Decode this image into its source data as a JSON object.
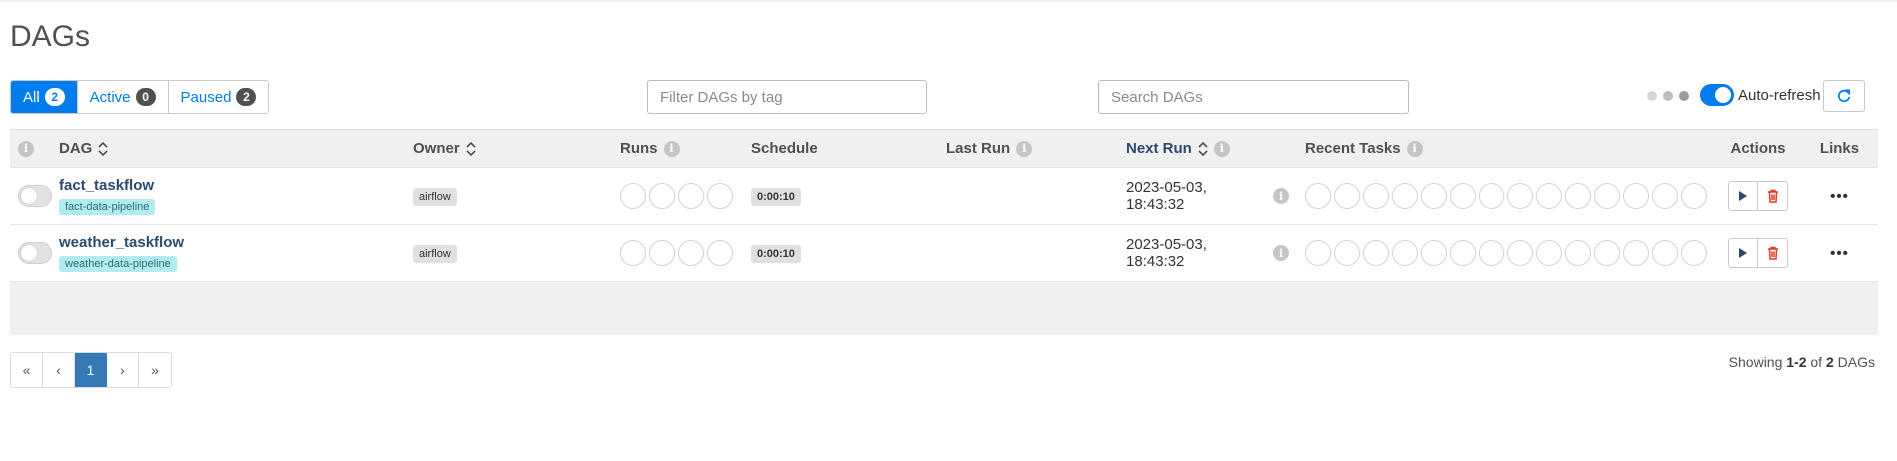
{
  "page": {
    "title": "DAGs"
  },
  "status_filter": [
    {
      "label": "All",
      "count": "2"
    },
    {
      "label": "Active",
      "count": "0"
    },
    {
      "label": "Paused",
      "count": "2"
    }
  ],
  "tag_filter": {
    "placeholder": "Filter DAGs by tag"
  },
  "search": {
    "placeholder": "Search DAGs"
  },
  "auto_refresh": {
    "label": "Auto-refresh",
    "enabled": true
  },
  "table": {
    "headers": {
      "toggle": "i",
      "dag": "DAG",
      "owner": "Owner",
      "runs": "Runs",
      "schedule": "Schedule",
      "last_run": "Last Run",
      "next_run": "Next Run",
      "recent_tasks": "Recent Tasks",
      "actions": "Actions",
      "links": "Links"
    },
    "info_glyph": "i",
    "rows": [
      {
        "dag_id": "fact_taskflow",
        "tag": "fact-data-pipeline",
        "owner": "airflow",
        "schedule": "0:00:10",
        "last_run": "",
        "next_run": "2023-05-03, 18:43:32",
        "paused": true
      },
      {
        "dag_id": "weather_taskflow",
        "tag": "weather-data-pipeline",
        "owner": "airflow",
        "schedule": "0:00:10",
        "last_run": "",
        "next_run": "2023-05-03, 18:43:32",
        "paused": true
      }
    ],
    "links_glyph": "•••"
  },
  "pagination": {
    "first": "«",
    "prev": "‹",
    "current": "1",
    "next": "›",
    "last": "»"
  },
  "showing": {
    "prefix": "Showing",
    "range": "1-2",
    "of": "of",
    "total": "2",
    "suffix": "DAGs"
  },
  "colors": {
    "accent": "#017cee",
    "tag_bg": "#b3ecf0",
    "delete": "#e43921"
  }
}
